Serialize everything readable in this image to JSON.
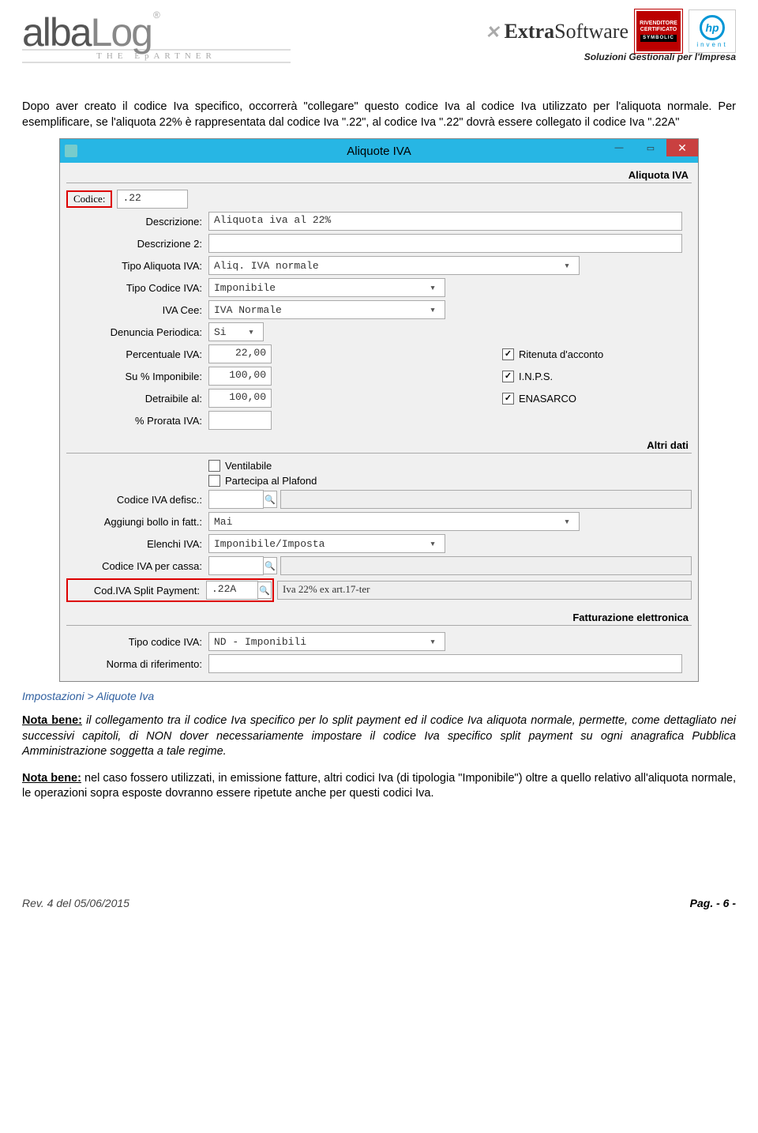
{
  "logos": {
    "albalog": "albaLog",
    "albalog_sub": "THE  EpARTNER",
    "extrasoft_prefix": "Extra",
    "extrasoft_suffix": "Software",
    "soluzioni": "Soluzioni Gestionali per l'Impresa",
    "badge_line1": "RIVENDITORE",
    "badge_line2": "CERTIFICATO",
    "badge_sym": "SYMBOLIC",
    "hp": "hp",
    "hp_invent": "invent"
  },
  "intro": "Dopo aver creato il codice Iva specifico, occorrerà \"collegare\" questo codice Iva al codice Iva utilizzato per l'aliquota normale. Per esemplificare, se l'aliquota 22% è rappresentata dal codice Iva \".22\", al codice Iva \".22\" dovrà essere collegato il codice Iva \".22A\"",
  "dialog": {
    "title": "Aliquote IVA",
    "sections": {
      "aliquota": "Aliquota IVA",
      "altri": "Altri dati",
      "fattel": "Fatturazione elettronica"
    },
    "fields": {
      "codice_label": "Codice:",
      "codice_value": ".22",
      "descr_label": "Descrizione:",
      "descr_value": "Aliquota iva al 22%",
      "descr2_label": "Descrizione 2:",
      "descr2_value": "",
      "tipoaliq_label": "Tipo Aliquota IVA:",
      "tipoaliq_value": "Aliq. IVA normale",
      "tipocod_label": "Tipo Codice IVA:",
      "tipocod_value": "Imponibile",
      "ivacee_label": "IVA Cee:",
      "ivacee_value": "IVA Normale",
      "denper_label": "Denuncia Periodica:",
      "denper_value": "Si",
      "perc_label": "Percentuale IVA:",
      "perc_value": "22,00",
      "suimp_label": "Su % Imponibile:",
      "suimp_value": "100,00",
      "detr_label": "Detraibile al:",
      "detr_value": "100,00",
      "prorata_label": "% Prorata IVA:",
      "prorata_value": "",
      "ritenuta_label": "Ritenuta d'acconto",
      "inps_label": "I.N.P.S.",
      "enasarco_label": "ENASARCO",
      "ventilabile_label": "Ventilabile",
      "plafond_label": "Partecipa al Plafond",
      "defisc_label": "Codice IVA defisc.:",
      "defisc_value": "",
      "bollo_label": "Aggiungi bollo in fatt.:",
      "bollo_value": "Mai",
      "elenchi_label": "Elenchi IVA:",
      "elenchi_value": "Imponibile/Imposta",
      "percassa_label": "Codice IVA per cassa:",
      "percassa_value": "",
      "split_label": "Cod.IVA Split Payment:",
      "split_value": ".22A",
      "split_desc": "Iva 22% ex art.17-ter",
      "tipocodfe_label": "Tipo codice IVA:",
      "tipocodfe_value": "ND - Imponibili",
      "norma_label": "Norma di riferimento:",
      "norma_value": ""
    }
  },
  "caption": "Impostazioni > Aliquote Iva",
  "nota1_label": "Nota bene:",
  "nota1_rest": " il collegamento tra il codice Iva specifico per lo split payment ed il codice Iva aliquota normale, permette, come dettagliato nei successivi capitoli, di NON dover necessariamente impostare il codice Iva specifico split payment su ogni anagrafica Pubblica Amministrazione soggetta a tale regime.",
  "nota2_label": "Nota bene:",
  "nota2_rest": " nel caso fossero utilizzati, in emissione fatture, altri codici Iva (di tipologia \"Imponibile\") oltre a quello relativo all'aliquota normale, le operazioni sopra esposte dovranno essere ripetute anche per questi codici Iva.",
  "footer": {
    "rev": "Rev. 4 del 05/06/2015",
    "pag": "Pag. - 6 -"
  }
}
